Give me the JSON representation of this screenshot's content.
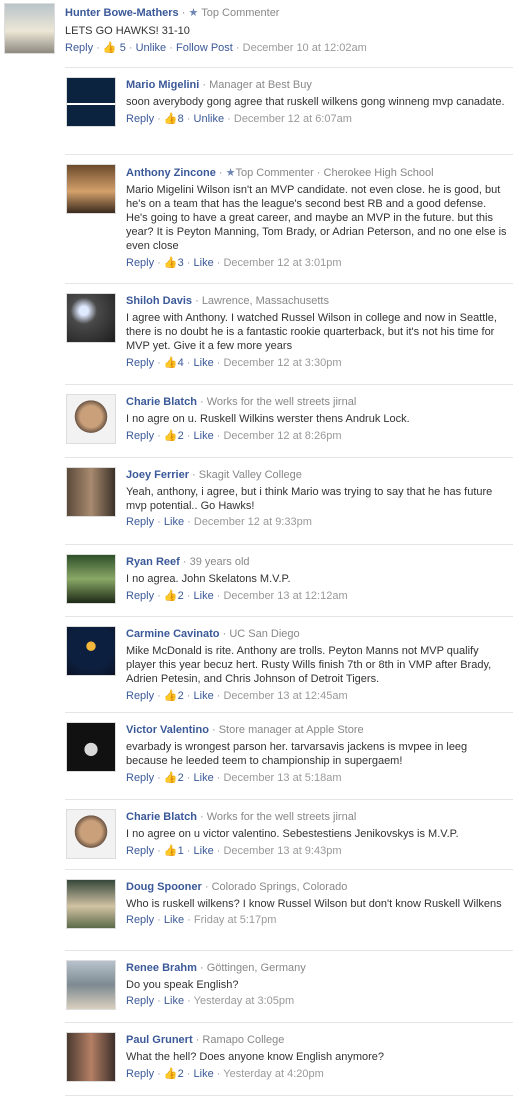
{
  "main": {
    "author": "Hunter Bowe-Mathers",
    "badge": "Top Commenter",
    "text": "LETS GO HAWKS! 31-10",
    "reply_label": "Reply",
    "like_count": "5",
    "unlike_label": "Unlike",
    "follow_label": "Follow Post",
    "time": "December 10 at 12:02am"
  },
  "replies": [
    {
      "name": "Mario Migelini",
      "meta": "Manager at Best Buy",
      "text": "soon averybody gong agree that ruskell wilkens gong winneng mvp canadate.",
      "likes": "8",
      "action": "Unlike",
      "time": "December 12 at 6:07am"
    },
    {
      "name": "Anthony Zincone",
      "meta": "Top Commenter · Cherokee High School",
      "text": "Mario Migelini Wilson isn't an MVP candidate. not even close. he is good, but he's on a team that has the league's second best RB and a good defense. He's going to have a great career, and maybe an MVP in the future. but this year? It is Peyton Manning, Tom Brady, or Adrian Peterson, and no one else is even close",
      "likes": "3",
      "action": "Like",
      "time": "December 12 at 3:01pm"
    },
    {
      "name": "Shiloh Davis",
      "meta": "Lawrence, Massachusetts",
      "text": "I agree with Anthony. I watched Russel Wilson in college and now in Seattle, there is no doubt he is a fantastic rookie quarterback, but it's not his time for MVP yet. Give it a few more years",
      "likes": "4",
      "action": "Like",
      "time": "December 12 at 3:30pm"
    },
    {
      "name": "Charie Blatch",
      "meta": "Works for the well streets jirnal",
      "text": "I no agre on u. Ruskell Wilkins werster thens Andruk Lock.",
      "likes": "2",
      "action": "Like",
      "time": "December 12 at 8:26pm"
    },
    {
      "name": "Joey Ferrier",
      "meta": "Skagit Valley College",
      "text": "Yeah, anthony, i agree, but i think Mario was trying to say that he has future mvp potential.. Go Hawks!",
      "likes": "",
      "action": "Like",
      "time": "December 12 at 9:33pm"
    },
    {
      "name": "Ryan Reef",
      "meta": "39 years old",
      "text": "I no agrea. John Skelatons M.V.P.",
      "likes": "2",
      "action": "Like",
      "time": "December 13 at 12:12am"
    },
    {
      "name": "Carmine Cavinato",
      "meta": "UC San Diego",
      "text": "Mike McDonald is rite. Anthony are trolls. Peyton Manns not MVP qualify player this year becuz hert. Rusty Wills finish 7th or 8th in VMP after Brady, Adrien Petesin, and Chris Johnson of Detroit Tigers.",
      "likes": "2",
      "action": "Like",
      "time": "December 13 at 12:45am"
    },
    {
      "name": "Victor Valentino",
      "meta": "Store manager at Apple Store",
      "text": "evarbady is wrongest parson her. tarvarsavis jackens is mvpee in leeg because he leeded teem to championship in supergaem!",
      "likes": "2",
      "action": "Like",
      "time": "December 13 at 5:18am"
    },
    {
      "name": "Charie Blatch",
      "meta": "Works for the well streets jirnal",
      "text": "I no agree on u victor valentino. Sebestestiens Jenikovskys is M.V.P.",
      "likes": "1",
      "action": "Like",
      "time": "December 13 at 9:43pm"
    },
    {
      "name": "Doug Spooner",
      "meta": "Colorado Springs, Colorado",
      "text": "Who is ruskell wilkens? I know Russel Wilson but don't know Ruskell Wilkens",
      "likes": "",
      "action": "Like",
      "time": "Friday at 5:17pm"
    },
    {
      "name": "Renee Brahm",
      "meta": "Göttingen, Germany",
      "text": "Do you speak English?",
      "likes": "",
      "action": "Like",
      "time": "Yesterday at 3:05pm"
    },
    {
      "name": "Paul Grunert",
      "meta": "Ramapo College",
      "text": "What the hell? Does anyone know English anymore?",
      "likes": "2",
      "action": "Like",
      "time": "Yesterday at 4:20pm"
    }
  ],
  "ui": {
    "separator": " · ",
    "thumb_icon": "thumbs-up-icon",
    "star_icon": "star-icon",
    "link_color": "#3b5998",
    "meta_color": "#888888"
  }
}
